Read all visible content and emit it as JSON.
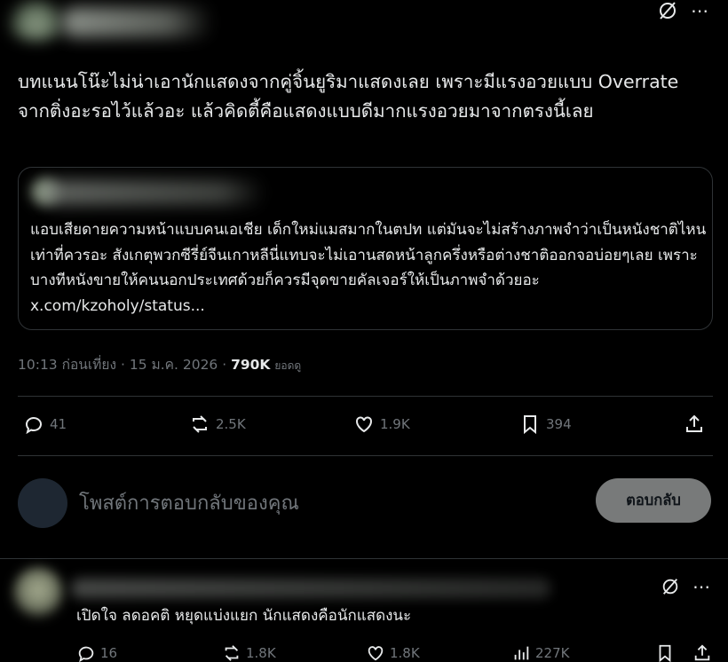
{
  "post": {
    "text": "บทแนนโน๊ะไม่น่าเอานักแสดงจากคู่จิ้นยูริมาแสดงเลย เพราะมีแรงอวยแบบ Overrate จากติ่งอะรอไว้แล้วอะ แล้วคิดตี้คือแสดงแบบดีมากแรงอวยมาจากตรงนี้เลย",
    "quote_text": "แอบเสียดายความหน้าแบบคนเอเชีย เด็กใหม่แมสมากในตปท แต่มันจะไม่สร้างภาพจำว่าเป็นหนังชาติไหนเท่าที่ควรอะ สังเกตุพวกซีรี่ย์จีนเกาหลีนี่แทบจะไม่เอานสดหน้าลูกครึ่งหรือต่างชาติออกจอบ่อยๆเลย เพราะบางทีหนังขายให้คนนอกประเทศด้วยก็ควรมีจุดขายคัลเจอร์ให้เป็นภาพจำด้วยอะ x.com/kzoholy/status...",
    "time": "10:13 ก่อนเที่ยง · 15 ม.ค. 2026 · ",
    "views": "790K",
    "views_label": "ยอดดู",
    "replies": "41",
    "reposts": "2.5K",
    "likes": "1.9K",
    "bookmarks": "394"
  },
  "reply_box": {
    "placeholder": "โพสต์การตอบกลับของคุณ",
    "button": "ตอบกลับ"
  },
  "reply_post": {
    "text": "เปิดใจ ลดอคติ หยุดแบ่งแยก นักแสดงคือนักแสดงนะ",
    "replies": "16",
    "reposts": "1.8K",
    "likes": "1.8K",
    "views": "227K"
  },
  "icons": [
    "grok-icon",
    "more-icon",
    "reply-icon",
    "repost-icon",
    "like-icon",
    "bookmark-icon",
    "share-icon",
    "views-icon"
  ],
  "colors": {
    "background": "#000000",
    "text": "#e7e9ea",
    "muted": "#71767b",
    "border": "#2f3336",
    "button": "#787a7a"
  }
}
